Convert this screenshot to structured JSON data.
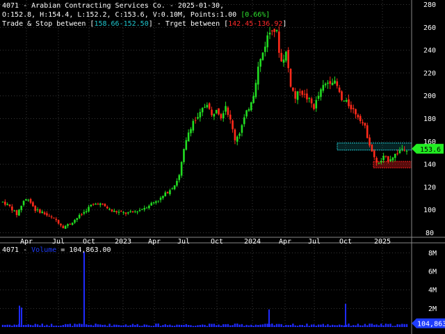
{
  "header": {
    "title": "4071 - Arabian Contracting Services Co. - 2025-01-30,",
    "ohlc": "O:152.8, H:154.4, L:152.2, C:153.6, V:0.10M, Points:1.00",
    "change": "[0.66%]",
    "trade_prefix": "Trade & Stop between [",
    "trade_range": "158.66-152.50",
    "target_mid": "] - Trget between [",
    "target_range": "142.45-136.92",
    "target_suffix": "]"
  },
  "volume_header": {
    "symbol": "4071 - ",
    "label": "Volume",
    "value": " = 104,863.00"
  },
  "last_price_label": "153.6",
  "last_volume_label": "104,863",
  "colors": {
    "up": "#22dd22",
    "down": "#ff2a1a",
    "volume": "#1f2bff",
    "trade_zone": "#1fc7cf",
    "target_zone": "#ff2020",
    "grid": "#3a3a3a"
  },
  "chart_data": [
    {
      "type": "candlestick",
      "title": "4071 - Arabian Contracting Services Co.",
      "y_ticks": [
        80,
        100,
        120,
        140,
        160,
        180,
        200,
        220,
        240,
        260,
        280
      ],
      "ylim": [
        76,
        284
      ],
      "x_ticks": [
        "Apr",
        "Jul",
        "Oct",
        "2023",
        "Apr",
        "Jul",
        "Oct",
        "2024",
        "Apr",
        "Jul",
        "Oct",
        "2025"
      ],
      "price_path": [
        [
          0,
          107
        ],
        [
          3,
          103
        ],
        [
          6,
          96
        ],
        [
          9,
          108
        ],
        [
          11,
          110
        ],
        [
          14,
          100
        ],
        [
          17,
          98
        ],
        [
          20,
          94
        ],
        [
          23,
          91
        ],
        [
          26,
          85
        ],
        [
          29,
          88
        ],
        [
          32,
          93
        ],
        [
          35,
          98
        ],
        [
          38,
          104
        ],
        [
          41,
          106
        ],
        [
          44,
          103
        ],
        [
          47,
          99
        ],
        [
          50,
          98
        ],
        [
          53,
          97
        ],
        [
          56,
          98
        ],
        [
          59,
          100
        ],
        [
          62,
          103
        ],
        [
          65,
          107
        ],
        [
          68,
          110
        ],
        [
          71,
          116
        ],
        [
          74,
          122
        ],
        [
          76,
          130
        ],
        [
          78,
          152
        ],
        [
          80,
          168
        ],
        [
          82,
          178
        ],
        [
          84,
          180
        ],
        [
          86,
          188
        ],
        [
          88,
          194
        ],
        [
          90,
          182
        ],
        [
          92,
          190
        ],
        [
          94,
          182
        ],
        [
          96,
          192
        ],
        [
          98,
          178
        ],
        [
          100,
          162
        ],
        [
          102,
          168
        ],
        [
          104,
          180
        ],
        [
          106,
          190
        ],
        [
          108,
          202
        ],
        [
          110,
          225
        ],
        [
          112,
          238
        ],
        [
          114,
          252
        ],
        [
          116,
          260
        ],
        [
          118,
          255
        ],
        [
          119,
          240
        ],
        [
          120,
          230
        ],
        [
          122,
          238
        ],
        [
          124,
          210
        ],
        [
          126,
          198
        ],
        [
          128,
          205
        ],
        [
          130,
          200
        ],
        [
          132,
          196
        ],
        [
          134,
          190
        ],
        [
          136,
          200
        ],
        [
          138,
          208
        ],
        [
          140,
          212
        ],
        [
          142,
          214
        ],
        [
          144,
          208
        ],
        [
          146,
          196
        ],
        [
          148,
          194
        ],
        [
          150,
          190
        ],
        [
          152,
          185
        ],
        [
          154,
          180
        ],
        [
          156,
          172
        ],
        [
          158,
          158
        ],
        [
          160,
          145
        ],
        [
          162,
          140
        ],
        [
          164,
          146
        ],
        [
          166,
          144
        ],
        [
          168,
          147
        ],
        [
          170,
          150
        ],
        [
          172,
          154
        ],
        [
          174,
          153.6
        ]
      ],
      "last": {
        "open": 152.8,
        "high": 154.4,
        "low": 152.2,
        "close": 153.6,
        "volume": "0.10M"
      },
      "trade_zone": [
        152.5,
        158.66
      ],
      "target_zone": [
        136.92,
        142.45
      ]
    },
    {
      "type": "bar",
      "title": "Volume",
      "y_ticks": [
        "2M",
        "4M",
        "6M",
        "8M"
      ],
      "ylim": [
        0,
        9000000
      ],
      "spikes": [
        {
          "x_label": "Apr",
          "value": 2300000
        },
        {
          "x_label": "Oct",
          "value": 8100000
        },
        {
          "x_label": "2024",
          "value": 1900000
        },
        {
          "x_label": "Oct",
          "value": 2500000
        }
      ],
      "last_value": 104863
    }
  ]
}
